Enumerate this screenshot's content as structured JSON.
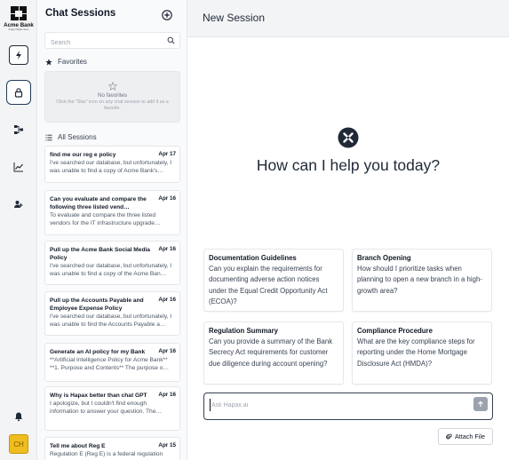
{
  "brand": {
    "name": "Acme Bank",
    "tagline": "Project Hapax demo"
  },
  "rail": {
    "items": [
      {
        "icon": "lightning-icon"
      },
      {
        "icon": "lock-icon"
      },
      {
        "icon": "flow-icon"
      },
      {
        "icon": "chart-icon"
      },
      {
        "icon": "users-icon"
      }
    ],
    "bell_icon": "bell-icon",
    "avatar_initials": "CH"
  },
  "sidebar": {
    "title": "Chat Sessions",
    "search_placeholder": "Search",
    "favorites_label": "Favorites",
    "favorites_empty_title": "No favorites",
    "favorites_empty_hint": "Click the \"Star\" icon on any chat session to add it as a favorite.",
    "all_sessions_label": "All Sessions",
    "sessions": [
      {
        "title": "find me our reg e policy",
        "date": "Apr 17",
        "snippet": "I've searched our database, but unfortunately, I was unable to find a copy of Acme Bank's…"
      },
      {
        "title": "Can you evaluate and compare the following three listed vend…",
        "date": "Apr 16",
        "snippet": "To evaluate and compare the three listed vendors for the IT infrastructure upgrade…"
      },
      {
        "title": "Pull up the Acme Bank Social Media Policy",
        "date": "Apr 16",
        "snippet": "I've searched our database, but unfortunately, I was unable to find a copy of the Acme Ban…"
      },
      {
        "title": "Pull up the Accounts Payable and Employee Expense Policy",
        "date": "Apr 16",
        "snippet": "I've searched our database, but unfortunately, I was unable to find the Accounts Payable a…"
      },
      {
        "title": "Generate an AI policy for my Bank",
        "date": "Apr 16",
        "snippet": "**Artificial Intelligence Policy for Acme Bank** **1. Purpose and Contents** The purpose o…"
      },
      {
        "title": "Why is Hapax better than chat GPT",
        "date": "Apr 16",
        "snippet": "I apologize, but I couldn't find enough information to answer your question. The…"
      },
      {
        "title": "Tell me about Reg E",
        "date": "Apr 15",
        "snippet": "Regulation E (Reg E) is a federal regulation"
      }
    ]
  },
  "main": {
    "page_title": "New Session",
    "hero": "How can I help you today?",
    "cards": [
      {
        "title": "Documentation Guidelines",
        "text": "Can you explain the requirements for documenting adverse action notices under the Equal Credit Opportunity Act (ECOA)?"
      },
      {
        "title": "Branch Opening",
        "text": "How should I prioritize tasks when planning to open a new branch in a high-growth area?"
      },
      {
        "title": "Regulation Summary",
        "text": "Can you provide a summary of the Bank Secrecy Act requirements for customer due diligence during account opening?"
      },
      {
        "title": "Compliance Procedure",
        "text": "What are the key compliance steps for reporting under the Home Mortgage Disclosure Act (HMDA)?"
      }
    ],
    "composer_placeholder": "Ask Hapax.ai",
    "attach_label": "Attach File"
  },
  "colors": {
    "accent": "#1f3b57",
    "avatar": "#f0bd1e",
    "send": "#9ca3af"
  }
}
